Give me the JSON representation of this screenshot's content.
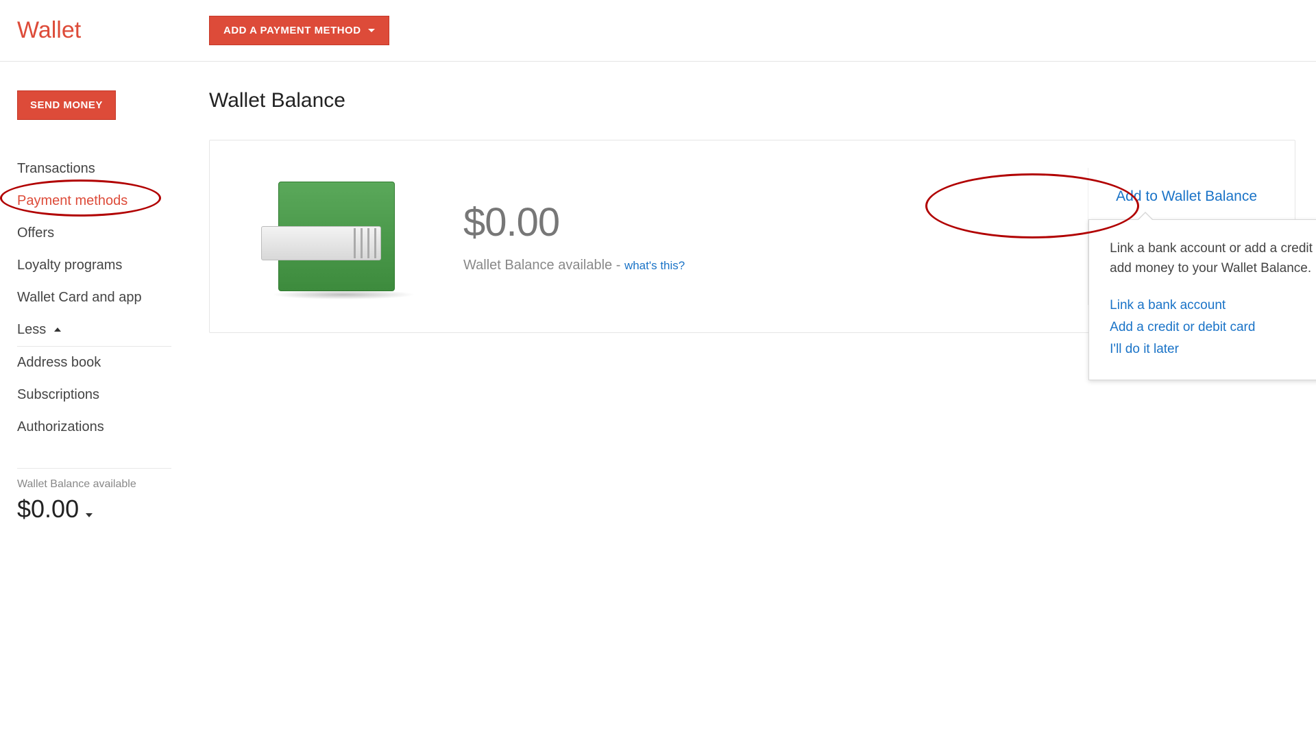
{
  "header": {
    "app_title": "Wallet",
    "add_payment_btn": "ADD A PAYMENT METHOD"
  },
  "sidebar": {
    "send_money_btn": "SEND MONEY",
    "nav": {
      "transactions": "Transactions",
      "payment_methods": "Payment methods",
      "offers": "Offers",
      "loyalty_programs": "Loyalty programs",
      "wallet_card_app": "Wallet Card and app",
      "less": "Less",
      "address_book": "Address book",
      "subscriptions": "Subscriptions",
      "authorizations": "Authorizations"
    },
    "balance_label": "Wallet Balance available",
    "balance_amount": "$0.00"
  },
  "main": {
    "page_title": "Wallet Balance",
    "balance_amount": "$0.00",
    "balance_sub_label": "Wallet Balance available - ",
    "whats_this": "what's this?",
    "add_to_balance": "Add to Wallet Balance"
  },
  "popover": {
    "body": "Link a bank account or add a credit or debit card to add money to your Wallet Balance.",
    "link_bank": "Link a bank account",
    "add_card": "Add a credit or debit card",
    "later": "I'll do it later"
  }
}
